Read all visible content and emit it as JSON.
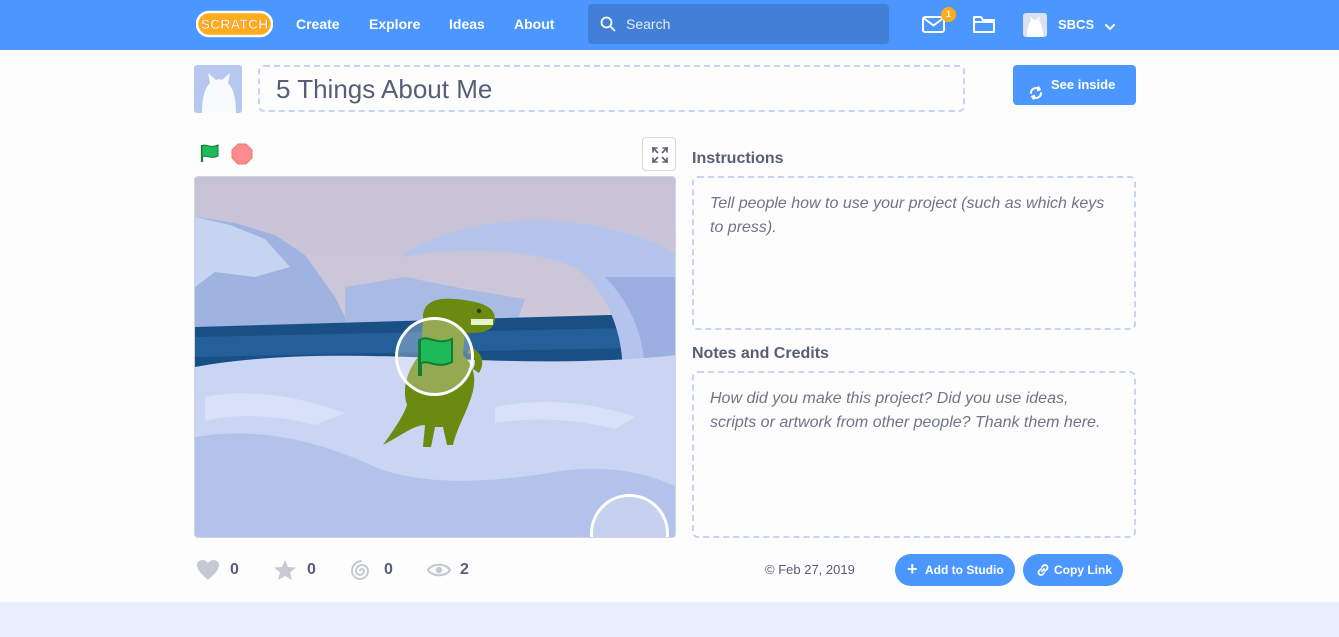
{
  "nav": {
    "logo_alt": "Scratch",
    "links": [
      "Create",
      "Explore",
      "Ideas",
      "About"
    ],
    "search_placeholder": "Search",
    "message_count": "1",
    "username": "SBCS",
    "icons": [
      "search-icon",
      "envelope-icon",
      "folder-icon",
      "chevron-down-icon"
    ]
  },
  "project": {
    "title": "5 Things About Me",
    "see_inside_label": "See inside"
  },
  "stats": {
    "loves": "0",
    "favorites": "0",
    "remixes": "0",
    "views": "2",
    "date": "Feb 27, 2019"
  },
  "actions": {
    "add_to_studio": "Add to Studio",
    "copy_link": "Copy Link"
  },
  "instructions": {
    "label": "Instructions",
    "placeholder": "Tell people how to use your project (such as which keys to press)."
  },
  "notes": {
    "label": "Notes and Credits",
    "placeholder": "How did you make this project? Did you use ideas, scripts or artwork from other people? Thank them here."
  },
  "colors": {
    "nav_blue": "#4c97ff",
    "search_blue": "#4280d7",
    "badge_orange": "#ffab1a",
    "text": "#575e75"
  }
}
